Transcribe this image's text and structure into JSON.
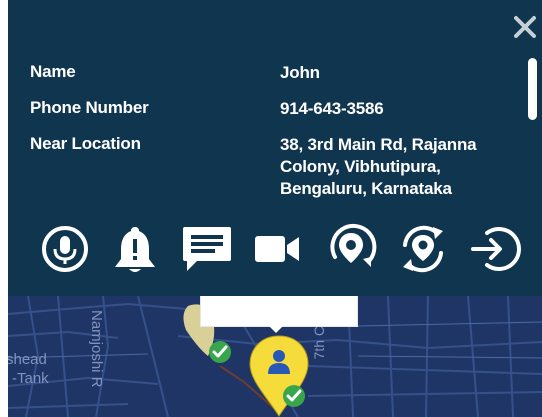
{
  "details": [
    {
      "label": "Name",
      "value": "John"
    },
    {
      "label": "Phone Number",
      "value": "914-643-3586"
    },
    {
      "label": "Near Location",
      "value": "38, 3rd Main Rd, Rajanna Colony, Vibhutipura, Bengaluru, Karnataka"
    }
  ],
  "icons": {
    "close": "close-icon",
    "actions": [
      "microphone-icon",
      "bell-alert-icon",
      "message-icon",
      "video-camera-icon",
      "location-refresh-icon",
      "location-sync-icon",
      "sign-in-icon"
    ]
  },
  "map": {
    "labels": {
      "street1": "Namjoshi R",
      "street2": "7th C",
      "place_line1": "shead",
      "place_line2": "-Tank"
    }
  },
  "colors": {
    "panel": "#10354f",
    "map": "#1f3566",
    "marker_yellow": "#f5dc3a",
    "check_green": "#3aa64b",
    "person_blue": "#2758b7"
  }
}
